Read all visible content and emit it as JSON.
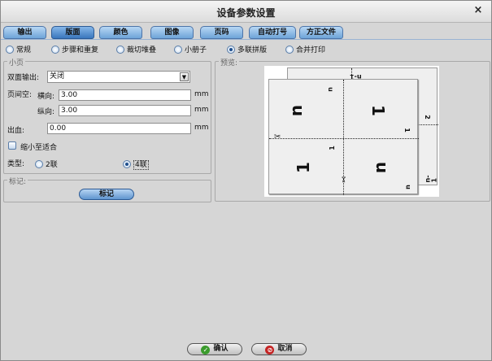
{
  "window": {
    "title": "设备参数设置",
    "close_glyph": "×"
  },
  "tabs": [
    {
      "label": "输出",
      "active": false
    },
    {
      "label": "版面",
      "active": true
    },
    {
      "label": "颜色",
      "active": false
    },
    {
      "label": "图像",
      "active": false
    },
    {
      "label": "页码",
      "active": false
    },
    {
      "label": "自动打号",
      "active": false
    },
    {
      "label": "方正文件",
      "active": false
    }
  ],
  "layout_modes": [
    {
      "label": "常规",
      "selected": false
    },
    {
      "label": "步骤和重复",
      "selected": false
    },
    {
      "label": "裁切堆叠",
      "selected": false
    },
    {
      "label": "小册子",
      "selected": false
    },
    {
      "label": "多联拼版",
      "selected": true
    },
    {
      "label": "合并打印",
      "selected": false
    }
  ],
  "small_page": {
    "group_label": "小页",
    "duplex_label": "双面输出:",
    "duplex_value": "关闭",
    "margin_label": "页间空:",
    "horizontal_label": "横向:",
    "horizontal_value": "3.00",
    "vertical_label": "纵向:",
    "vertical_value": "3.00",
    "bleed_label": "出血:",
    "bleed_value": "0.00",
    "unit": "mm",
    "shrink_to_fit_label": "缩小至适合",
    "shrink_to_fit_checked": false,
    "type_label": "类型:",
    "type_options": [
      {
        "label": "2联",
        "selected": false
      },
      {
        "label": "4联",
        "selected": true
      }
    ]
  },
  "marks": {
    "group_label": "标记:",
    "button_label": "标记"
  },
  "preview": {
    "group_label": "预览:",
    "glyphs": {
      "u": "u",
      "one": "1",
      "n": "n",
      "n_minus_1": "n-1",
      "two": "2",
      "scissors": "✂"
    }
  },
  "footer": {
    "ok_label": "确认",
    "ok_icon": "check-icon",
    "cancel_label": "取消",
    "cancel_icon": "no-entry-icon",
    "ok_color": "#3a9b2c",
    "cancel_color": "#c42424"
  }
}
